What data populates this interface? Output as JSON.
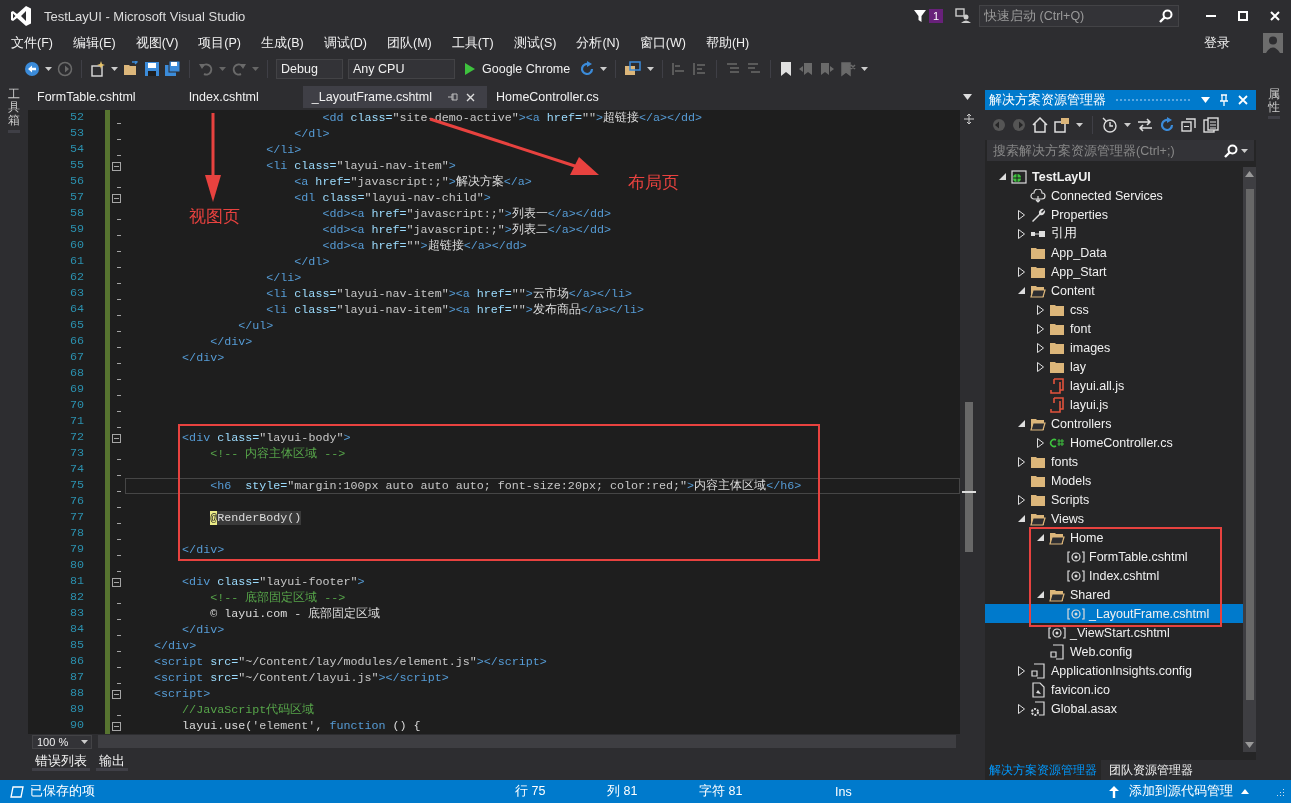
{
  "window": {
    "title": "TestLayUI - Microsoft Visual Studio",
    "notifications": "1",
    "quick_launch": {
      "placeholder": "快速启动 (Ctrl+Q)"
    }
  },
  "menu": [
    "文件(F)",
    "编辑(E)",
    "视图(V)",
    "项目(P)",
    "生成(B)",
    "调试(D)",
    "团队(M)",
    "工具(T)",
    "测试(S)",
    "分析(N)",
    "窗口(W)",
    "帮助(H)"
  ],
  "account": "登录",
  "toolbar": {
    "configuration": "Debug",
    "platform": "Any CPU",
    "run_target": "Google Chrome"
  },
  "left_strip": "工具箱",
  "right_strip": "属性",
  "editor": {
    "tabs": [
      {
        "label": "FormTable.cshtml",
        "selected": false
      },
      {
        "label": "Index.cshtml",
        "selected": false
      },
      {
        "label": "_LayoutFrame.cshtml",
        "selected": true
      },
      {
        "label": "HomeController.cs",
        "selected": false
      }
    ],
    "lines": [
      {
        "number": "52",
        "fold": false,
        "current": false,
        "tokens": [
          {
            "kind": "tag",
            "text": "                            <dd"
          },
          {
            "kind": "attr",
            "text": " class="
          },
          {
            "kind": "value",
            "text": "\"site-demo-active\""
          },
          {
            "kind": "tag",
            "text": "><a"
          },
          {
            "kind": "attr",
            "text": " href="
          },
          {
            "kind": "value",
            "text": "\"\""
          },
          {
            "kind": "tag",
            "text": ">"
          },
          {
            "kind": "text",
            "text": "超链接"
          },
          {
            "kind": "tag",
            "text": "</a></dd>"
          }
        ]
      },
      {
        "number": "53",
        "fold": false,
        "current": false,
        "tokens": [
          {
            "kind": "tag",
            "text": "                        </dl>"
          }
        ]
      },
      {
        "number": "54",
        "fold": false,
        "current": false,
        "tokens": [
          {
            "kind": "tag",
            "text": "                    </li>"
          }
        ]
      },
      {
        "number": "55",
        "fold": true,
        "current": false,
        "tokens": [
          {
            "kind": "tag",
            "text": "                    <li"
          },
          {
            "kind": "attr",
            "text": " class="
          },
          {
            "kind": "value",
            "text": "\"layui-nav-item\""
          },
          {
            "kind": "tag",
            "text": ">"
          }
        ]
      },
      {
        "number": "56",
        "fold": false,
        "current": false,
        "tokens": [
          {
            "kind": "tag",
            "text": "                        <a"
          },
          {
            "kind": "attr",
            "text": " href="
          },
          {
            "kind": "value",
            "text": "\"javascript:;\""
          },
          {
            "kind": "tag",
            "text": ">"
          },
          {
            "kind": "text",
            "text": "解决方案"
          },
          {
            "kind": "tag",
            "text": "</a>"
          }
        ]
      },
      {
        "number": "57",
        "fold": true,
        "current": false,
        "tokens": [
          {
            "kind": "tag",
            "text": "                        <dl"
          },
          {
            "kind": "attr",
            "text": " class="
          },
          {
            "kind": "value",
            "text": "\"layui-nav-child\""
          },
          {
            "kind": "tag",
            "text": ">"
          }
        ]
      },
      {
        "number": "58",
        "fold": false,
        "current": false,
        "tokens": [
          {
            "kind": "tag",
            "text": "                            <dd><a"
          },
          {
            "kind": "attr",
            "text": " href="
          },
          {
            "kind": "value",
            "text": "\"javascript:;\""
          },
          {
            "kind": "tag",
            "text": ">"
          },
          {
            "kind": "text",
            "text": "列表一"
          },
          {
            "kind": "tag",
            "text": "</a></dd>"
          }
        ]
      },
      {
        "number": "59",
        "fold": false,
        "current": false,
        "tokens": [
          {
            "kind": "tag",
            "text": "                            <dd><a"
          },
          {
            "kind": "attr",
            "text": " href="
          },
          {
            "kind": "value",
            "text": "\"javascript:;\""
          },
          {
            "kind": "tag",
            "text": ">"
          },
          {
            "kind": "text",
            "text": "列表二"
          },
          {
            "kind": "tag",
            "text": "</a></dd>"
          }
        ]
      },
      {
        "number": "60",
        "fold": false,
        "current": false,
        "tokens": [
          {
            "kind": "tag",
            "text": "                            <dd><a"
          },
          {
            "kind": "attr",
            "text": " href="
          },
          {
            "kind": "value",
            "text": "\"\""
          },
          {
            "kind": "tag",
            "text": ">"
          },
          {
            "kind": "text",
            "text": "超链接"
          },
          {
            "kind": "tag",
            "text": "</a></dd>"
          }
        ]
      },
      {
        "number": "61",
        "fold": false,
        "current": false,
        "tokens": [
          {
            "kind": "tag",
            "text": "                        </dl>"
          }
        ]
      },
      {
        "number": "62",
        "fold": false,
        "current": false,
        "tokens": [
          {
            "kind": "tag",
            "text": "                    </li>"
          }
        ]
      },
      {
        "number": "63",
        "fold": false,
        "current": false,
        "tokens": [
          {
            "kind": "tag",
            "text": "                    <li"
          },
          {
            "kind": "attr",
            "text": " class="
          },
          {
            "kind": "value",
            "text": "\"layui-nav-item\""
          },
          {
            "kind": "tag",
            "text": "><a"
          },
          {
            "kind": "attr",
            "text": " href="
          },
          {
            "kind": "value",
            "text": "\"\""
          },
          {
            "kind": "tag",
            "text": ">"
          },
          {
            "kind": "text",
            "text": "云市场"
          },
          {
            "kind": "tag",
            "text": "</a></li>"
          }
        ]
      },
      {
        "number": "64",
        "fold": false,
        "current": false,
        "tokens": [
          {
            "kind": "tag",
            "text": "                    <li"
          },
          {
            "kind": "attr",
            "text": " class="
          },
          {
            "kind": "value",
            "text": "\"layui-nav-item\""
          },
          {
            "kind": "tag",
            "text": "><a"
          },
          {
            "kind": "attr",
            "text": " href="
          },
          {
            "kind": "value",
            "text": "\"\""
          },
          {
            "kind": "tag",
            "text": ">"
          },
          {
            "kind": "text",
            "text": "发布商品"
          },
          {
            "kind": "tag",
            "text": "</a></li>"
          }
        ]
      },
      {
        "number": "65",
        "fold": false,
        "current": false,
        "tokens": [
          {
            "kind": "tag",
            "text": "                </ul>"
          }
        ]
      },
      {
        "number": "66",
        "fold": false,
        "current": false,
        "tokens": [
          {
            "kind": "tag",
            "text": "            </div>"
          }
        ]
      },
      {
        "number": "67",
        "fold": false,
        "current": false,
        "tokens": [
          {
            "kind": "tag",
            "text": "        </div>"
          }
        ]
      },
      {
        "number": "68",
        "fold": false,
        "current": false
      },
      {
        "number": "69",
        "fold": false,
        "current": false
      },
      {
        "number": "70",
        "fold": false,
        "current": false
      },
      {
        "number": "71",
        "fold": false,
        "current": false
      },
      {
        "number": "72",
        "fold": true,
        "current": false,
        "tokens": [
          {
            "kind": "tag",
            "text": "        <div"
          },
          {
            "kind": "attr",
            "text": " class="
          },
          {
            "kind": "value",
            "text": "\"layui-body\""
          },
          {
            "kind": "tag",
            "text": ">"
          }
        ]
      },
      {
        "number": "73",
        "fold": false,
        "current": false,
        "tokens": [
          {
            "kind": "comment",
            "text": "            <!-- 内容主体区域 -->"
          }
        ]
      },
      {
        "number": "74",
        "fold": false,
        "current": false
      },
      {
        "number": "75",
        "fold": false,
        "current": true,
        "tokens": [
          {
            "kind": "tag",
            "text": "            <h6"
          },
          {
            "kind": "attr",
            "text": "  style="
          },
          {
            "kind": "value",
            "text": "\"margin:100px auto auto auto; font-size:20px; color:red;\""
          },
          {
            "kind": "tag",
            "text": ">"
          },
          {
            "kind": "text",
            "text": "内容主体区域"
          },
          {
            "kind": "tag",
            "text": "</h6>"
          }
        ]
      },
      {
        "number": "76",
        "fold": false,
        "current": false
      },
      {
        "number": "77",
        "fold": false,
        "current": false,
        "tokens": [
          {
            "kind": "razor",
            "text": "            @"
          },
          {
            "kind": "razor-call",
            "text": "RenderBody()"
          }
        ]
      },
      {
        "number": "78",
        "fold": false,
        "current": false
      },
      {
        "number": "79",
        "fold": false,
        "current": false,
        "tokens": [
          {
            "kind": "tag",
            "text": "        </div>"
          }
        ]
      },
      {
        "number": "80",
        "fold": false,
        "current": false
      },
      {
        "number": "81",
        "fold": true,
        "current": false,
        "tokens": [
          {
            "kind": "tag",
            "text": "        <div"
          },
          {
            "kind": "attr",
            "text": " class="
          },
          {
            "kind": "value",
            "text": "\"layui-footer\""
          },
          {
            "kind": "tag",
            "text": ">"
          }
        ]
      },
      {
        "number": "82",
        "fold": false,
        "current": false,
        "tokens": [
          {
            "kind": "comment",
            "text": "            <!-- 底部固定区域 -->"
          }
        ]
      },
      {
        "number": "83",
        "fold": false,
        "current": false,
        "tokens": [
          {
            "kind": "text",
            "text": "            © layui.com - 底部固定区域"
          }
        ]
      },
      {
        "number": "84",
        "fold": false,
        "current": false,
        "tokens": [
          {
            "kind": "tag",
            "text": "        </div>"
          }
        ]
      },
      {
        "number": "85",
        "fold": false,
        "current": false,
        "tokens": [
          {
            "kind": "tag",
            "text": "    </div>"
          }
        ]
      },
      {
        "number": "86",
        "fold": false,
        "current": false,
        "tokens": [
          {
            "kind": "tag",
            "text": "    <script"
          },
          {
            "kind": "attr",
            "text": " src="
          },
          {
            "kind": "value",
            "text": "\"~/Content/lay/modules/element.js\""
          },
          {
            "kind": "tag",
            "text": "></script>"
          }
        ]
      },
      {
        "number": "87",
        "fold": false,
        "current": false,
        "tokens": [
          {
            "kind": "tag",
            "text": "    <script"
          },
          {
            "kind": "attr",
            "text": " src="
          },
          {
            "kind": "value",
            "text": "\"~/Content/layui.js\""
          },
          {
            "kind": "tag",
            "text": "></script>"
          }
        ]
      },
      {
        "number": "88",
        "fold": true,
        "current": false,
        "tokens": [
          {
            "kind": "tag",
            "text": "    <script>"
          }
        ]
      },
      {
        "number": "89",
        "fold": false,
        "current": false,
        "tokens": [
          {
            "kind": "comment",
            "text": "        //JavaScript代码区域"
          }
        ]
      },
      {
        "number": "90",
        "fold": true,
        "current": false,
        "tokens": [
          {
            "kind": "text",
            "text": "        layui.use("
          },
          {
            "kind": "value",
            "text": "'element'"
          },
          {
            "kind": "text",
            "text": ", "
          },
          {
            "kind": "keyword",
            "text": "function"
          },
          {
            "kind": "text",
            "text": " () {"
          }
        ]
      }
    ],
    "zoom": "100 %"
  },
  "annotations": [
    {
      "text": "视图页"
    },
    {
      "text": "布局页"
    }
  ],
  "bottom_tabs": [
    "错误列表",
    "输出"
  ],
  "solution_explorer": {
    "title": "解决方案资源管理器",
    "search": {
      "placeholder": "搜索解决方案资源管理器(Ctrl+;)"
    },
    "tree": [
      {
        "label": "TestLayUI",
        "kind": "project",
        "expanded": true,
        "selected": false,
        "children": [
          {
            "label": "Connected Services",
            "kind": "cloud",
            "selected": false
          },
          {
            "label": "Properties",
            "kind": "wrench",
            "expanded": false,
            "selected": false
          },
          {
            "label": "引用",
            "kind": "references",
            "expanded": false,
            "selected": false
          },
          {
            "label": "App_Data",
            "kind": "folder",
            "selected": false
          },
          {
            "label": "App_Start",
            "kind": "folder",
            "expanded": false,
            "selected": false
          },
          {
            "label": "Content",
            "kind": "folder",
            "expanded": true,
            "selected": false,
            "children": [
              {
                "label": "css",
                "kind": "folder",
                "expanded": false,
                "selected": false
              },
              {
                "label": "font",
                "kind": "folder",
                "expanded": false,
                "selected": false
              },
              {
                "label": "images",
                "kind": "folder",
                "expanded": false,
                "selected": false
              },
              {
                "label": "lay",
                "kind": "folder",
                "expanded": false,
                "selected": false
              },
              {
                "label": "layui.all.js",
                "kind": "script",
                "selected": false
              },
              {
                "label": "layui.js",
                "kind": "script",
                "selected": false
              }
            ]
          },
          {
            "label": "Controllers",
            "kind": "folder",
            "expanded": true,
            "selected": false,
            "children": [
              {
                "label": "HomeController.cs",
                "kind": "csharp",
                "expanded": false,
                "selected": false
              }
            ]
          },
          {
            "label": "fonts",
            "kind": "folder",
            "expanded": false,
            "selected": false
          },
          {
            "label": "Models",
            "kind": "folder",
            "selected": false
          },
          {
            "label": "Scripts",
            "kind": "folder",
            "expanded": false,
            "selected": false
          },
          {
            "label": "Views",
            "kind": "folder",
            "expanded": true,
            "selected": false,
            "children": [
              {
                "label": "Home",
                "kind": "folder",
                "expanded": true,
                "selected": false,
                "children": [
                  {
                    "label": "FormTable.cshtml",
                    "kind": "razor",
                    "selected": false
                  },
                  {
                    "label": "Index.cshtml",
                    "kind": "razor",
                    "selected": false
                  }
                ]
              },
              {
                "label": "Shared",
                "kind": "folder",
                "expanded": true,
                "selected": false,
                "children": [
                  {
                    "label": "_LayoutFrame.cshtml",
                    "kind": "razor",
                    "selected": true
                  }
                ]
              },
              {
                "label": "_ViewStart.cshtml",
                "kind": "razor",
                "selected": false
              },
              {
                "label": "Web.config",
                "kind": "config",
                "selected": false
              }
            ]
          },
          {
            "label": "ApplicationInsights.config",
            "kind": "config",
            "expanded": false,
            "selected": false
          },
          {
            "label": "favicon.ico",
            "kind": "image",
            "selected": false
          },
          {
            "label": "Global.asax",
            "kind": "asax",
            "expanded": false,
            "selected": false
          }
        ]
      }
    ],
    "tabs": [
      {
        "label": "解决方案资源管理器",
        "selected": true
      },
      {
        "label": "团队资源管理器",
        "selected": false
      }
    ]
  },
  "status_bar": {
    "message": "已保存的项",
    "line": "行 75",
    "column": "列 81",
    "char": "字符 81",
    "mode": "Ins",
    "source_control": "添加到源代码管理"
  }
}
